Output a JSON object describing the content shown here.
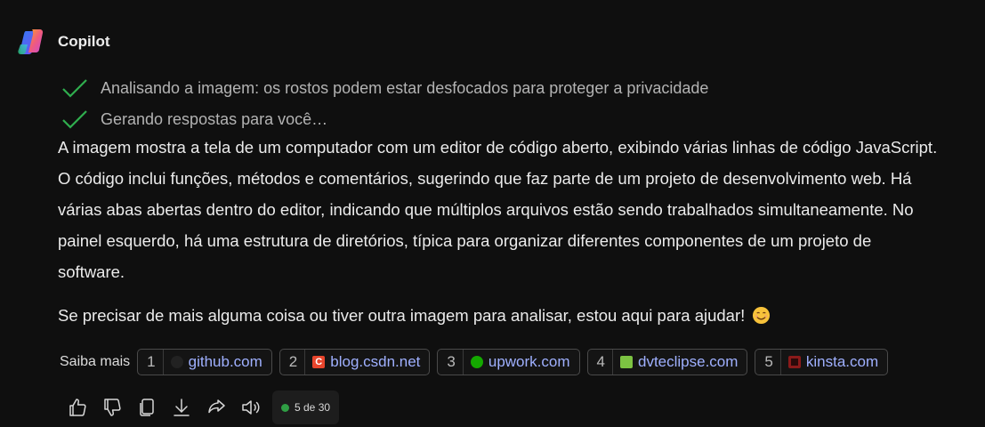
{
  "assistant": {
    "name": "Copilot"
  },
  "progress": [
    {
      "text": "Analisando a imagem: os rostos podem estar desfocados para proteger a privacidade",
      "icon": "checkmark-icon"
    },
    {
      "text": "Gerando respostas para você…",
      "icon": "checkmark-icon"
    }
  ],
  "answer": {
    "paragraph1": "A imagem mostra a tela de um computador com um editor de código aberto, exibindo várias linhas de código JavaScript. O código inclui funções, métodos e comentários, sugerindo que faz parte de um projeto de desenvolvimento web. Há várias abas abertas dentro do editor, indicando que múltiplos arquivos estão sendo trabalhados simultaneamente. No painel esquerdo, há uma estrutura de diretórios, típica para organizar diferentes componentes de um projeto de software.",
    "paragraph2": "Se precisar de mais alguma coisa ou tiver outra imagem para analisar, estou aqui para ajudar!"
  },
  "sources": {
    "label": "Saiba mais",
    "items": [
      {
        "num": "1",
        "label": "github.com",
        "color": "#222222"
      },
      {
        "num": "2",
        "label": "blog.csdn.net",
        "color": "#e8452c"
      },
      {
        "num": "3",
        "label": "upwork.com",
        "color": "#14a800"
      },
      {
        "num": "4",
        "label": "dvteclipse.com",
        "color": "#7cc242"
      },
      {
        "num": "5",
        "label": "kinsta.com",
        "color": "#8a1a1a"
      }
    ]
  },
  "actions": {
    "counter": "5 de 30",
    "icons": [
      "thumbs-up-icon",
      "thumbs-down-icon",
      "copy-icon",
      "download-icon",
      "share-icon",
      "speaker-icon"
    ]
  },
  "colors": {
    "check": "#2fae4e",
    "link": "#9fb0ff",
    "background": "#0f0f0f"
  }
}
